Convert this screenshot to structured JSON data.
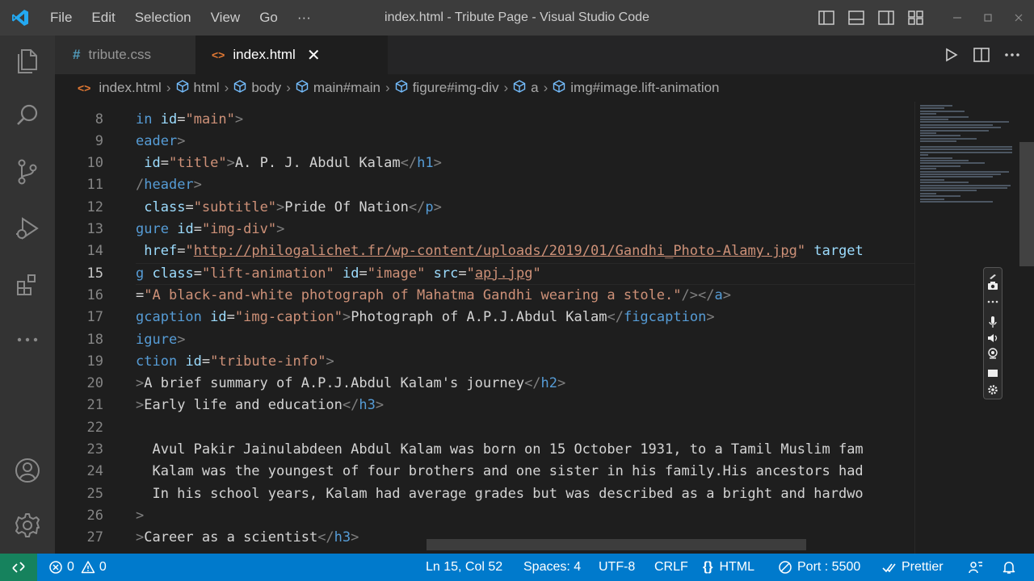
{
  "titlebar": {
    "menu": [
      "File",
      "Edit",
      "Selection",
      "View",
      "Go",
      "···"
    ],
    "window_title": "index.html - Tribute Page - Visual Studio Code"
  },
  "tabs": [
    {
      "icon": "#",
      "label": "tribute.css",
      "active": false
    },
    {
      "icon": "<>",
      "label": "index.html",
      "active": true,
      "close": "✕"
    }
  ],
  "breadcrumb": [
    {
      "label": "index.html",
      "kind": "file"
    },
    {
      "label": "html",
      "kind": "element"
    },
    {
      "label": "body",
      "kind": "element"
    },
    {
      "label": "main#main",
      "kind": "element"
    },
    {
      "label": "figure#img-div",
      "kind": "element"
    },
    {
      "label": "a",
      "kind": "element"
    },
    {
      "label": "img#image.lift-animation",
      "kind": "element"
    }
  ],
  "editor": {
    "current_line": 15,
    "line_numbers": [
      "8",
      "9",
      "10",
      "11",
      "12",
      "13",
      "14",
      "15",
      "16",
      "17",
      "18",
      "19",
      "20",
      "21",
      "22",
      "23",
      "24",
      "25",
      "26",
      "27"
    ],
    "lines": [
      [
        [
          "tg",
          "in"
        ],
        [
          "tx",
          " "
        ],
        [
          "at",
          "id"
        ],
        [
          "tx",
          "="
        ],
        [
          "st",
          "\"main\""
        ],
        [
          "br",
          ">"
        ]
      ],
      [
        [
          "tg",
          "eader"
        ],
        [
          "br",
          ">"
        ]
      ],
      [
        [
          "tx",
          " "
        ],
        [
          "at",
          "id"
        ],
        [
          "tx",
          "="
        ],
        [
          "st",
          "\"title\""
        ],
        [
          "br",
          ">"
        ],
        [
          "tx",
          "A. P. J. Abdul Kalam"
        ],
        [
          "br",
          "</"
        ],
        [
          "tg",
          "h1"
        ],
        [
          "br",
          ">"
        ]
      ],
      [
        [
          "br",
          "/"
        ],
        [
          "tg",
          "header"
        ],
        [
          "br",
          ">"
        ]
      ],
      [
        [
          "tx",
          " "
        ],
        [
          "at",
          "class"
        ],
        [
          "tx",
          "="
        ],
        [
          "st",
          "\"subtitle\""
        ],
        [
          "br",
          ">"
        ],
        [
          "tx",
          "Pride Of Nation"
        ],
        [
          "br",
          "</"
        ],
        [
          "tg",
          "p"
        ],
        [
          "br",
          ">"
        ]
      ],
      [
        [
          "tg",
          "gure"
        ],
        [
          "tx",
          " "
        ],
        [
          "at",
          "id"
        ],
        [
          "tx",
          "="
        ],
        [
          "st",
          "\"img-div\""
        ],
        [
          "br",
          ">"
        ]
      ],
      [
        [
          "tx",
          " "
        ],
        [
          "at",
          "href"
        ],
        [
          "tx",
          "="
        ],
        [
          "st",
          "\""
        ],
        [
          "lk",
          "http://philogalichet.fr/wp-content/uploads/2019/01/Gandhi_Photo-Alamy.jpg"
        ],
        [
          "st",
          "\""
        ],
        [
          "tx",
          " "
        ],
        [
          "at",
          "target"
        ]
      ],
      [
        [
          "tg",
          "g"
        ],
        [
          "tx",
          " "
        ],
        [
          "at",
          "class"
        ],
        [
          "tx",
          "="
        ],
        [
          "st",
          "\"lift-animation\""
        ],
        [
          "tx",
          " "
        ],
        [
          "at",
          "id"
        ],
        [
          "tx",
          "="
        ],
        [
          "st",
          "\"image\""
        ],
        [
          "tx",
          " "
        ],
        [
          "at",
          "src"
        ],
        [
          "tx",
          "="
        ],
        [
          "st",
          "\""
        ],
        [
          "lk",
          "apj.jpg"
        ],
        [
          "st",
          "\""
        ]
      ],
      [
        [
          "tx",
          "="
        ],
        [
          "st",
          "\"A black-and-white photograph of Mahatma Gandhi wearing a stole.\""
        ],
        [
          "br",
          "/></"
        ],
        [
          "tg",
          "a"
        ],
        [
          "br",
          ">"
        ]
      ],
      [
        [
          "tg",
          "gcaption"
        ],
        [
          "tx",
          " "
        ],
        [
          "at",
          "id"
        ],
        [
          "tx",
          "="
        ],
        [
          "st",
          "\"img-caption\""
        ],
        [
          "br",
          ">"
        ],
        [
          "tx",
          "Photograph of A.P.J.Abdul Kalam"
        ],
        [
          "br",
          "</"
        ],
        [
          "tg",
          "figcaption"
        ],
        [
          "br",
          ">"
        ]
      ],
      [
        [
          "tg",
          "igure"
        ],
        [
          "br",
          ">"
        ]
      ],
      [
        [
          "tg",
          "ction"
        ],
        [
          "tx",
          " "
        ],
        [
          "at",
          "id"
        ],
        [
          "tx",
          "="
        ],
        [
          "st",
          "\"tribute-info\""
        ],
        [
          "br",
          ">"
        ]
      ],
      [
        [
          "br",
          ">"
        ],
        [
          "tx",
          "A brief summary of A.P.J.Abdul Kalam's journey"
        ],
        [
          "br",
          "</"
        ],
        [
          "tg",
          "h2"
        ],
        [
          "br",
          ">"
        ]
      ],
      [
        [
          "br",
          ">"
        ],
        [
          "tx",
          "Early life and education"
        ],
        [
          "br",
          "</"
        ],
        [
          "tg",
          "h3"
        ],
        [
          "br",
          ">"
        ]
      ],
      [],
      [
        [
          "tx",
          "  Avul Pakir Jainulabdeen Abdul Kalam was born on 15 October 1931, to a Tamil Muslim fam"
        ]
      ],
      [
        [
          "tx",
          "  Kalam was the youngest of four brothers and one sister in his family.His ancestors had"
        ]
      ],
      [
        [
          "tx",
          "  In his school years, Kalam had average grades but was described as a bright and hardwo"
        ]
      ],
      [
        [
          "br",
          ">"
        ]
      ],
      [
        [
          "br",
          ">"
        ],
        [
          "tx",
          "Career as a scientist"
        ],
        [
          "br",
          "</"
        ],
        [
          "tg",
          "h3"
        ],
        [
          "br",
          ">"
        ]
      ]
    ]
  },
  "statusbar": {
    "errors": "0",
    "warnings": "0",
    "position": "Ln 15, Col 52",
    "spaces": "Spaces: 4",
    "encoding": "UTF-8",
    "eol": "CRLF",
    "language": "HTML",
    "port": "Port : 5500",
    "formatter": "Prettier"
  },
  "colors": {
    "statusbar": "#007acc",
    "remote": "#16825d",
    "activitybar": "#333333",
    "titlebar": "#3c3c3c",
    "editor_bg": "#1e1e1e"
  }
}
